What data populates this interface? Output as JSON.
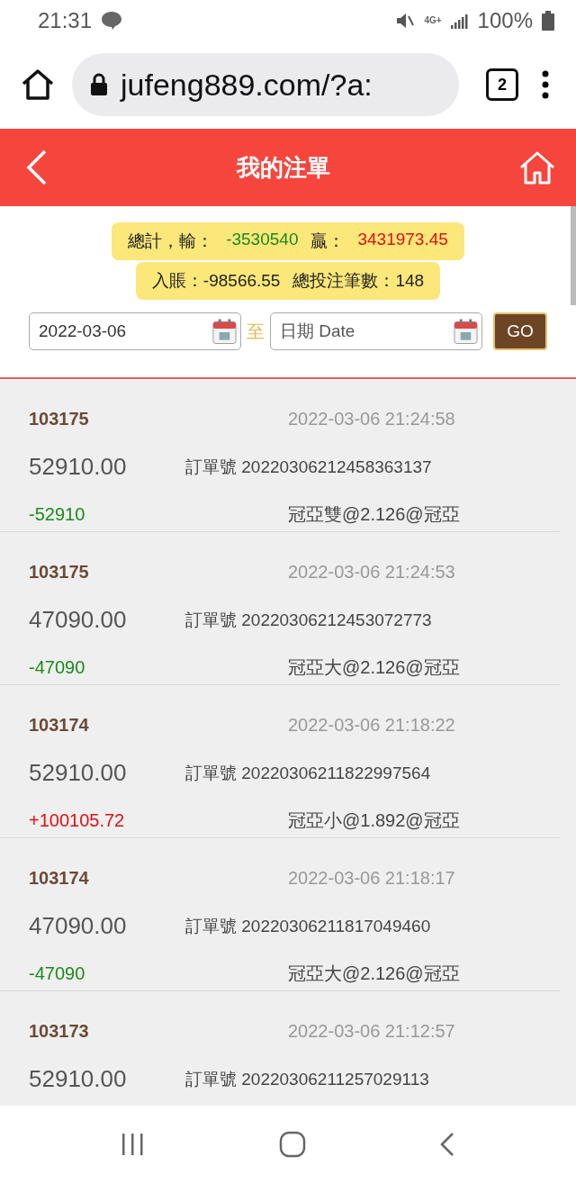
{
  "status_bar": {
    "time": "21:31",
    "network": "4G+",
    "battery": "100%"
  },
  "browser": {
    "url": "jufeng889.com/?a:",
    "tab_count": "2"
  },
  "header": {
    "title": "我的注單"
  },
  "summary": {
    "line1": [
      {
        "text": "總計，輸：",
        "color": "#222222"
      },
      {
        "text": "-3530540",
        "color": "#1a8a1a"
      },
      {
        "text": "贏：",
        "color": "#222222"
      },
      {
        "text": "3431973.45",
        "color": "#e01010"
      }
    ],
    "line2": [
      {
        "text": "入賬：-98566.55",
        "color": "#222222"
      },
      {
        "text": "總投注筆數：148",
        "color": "#222222"
      }
    ]
  },
  "filter": {
    "from": "2022-03-06",
    "separator": "至",
    "to_placeholder": "日期 Date",
    "go": "GO"
  },
  "bets": [
    {
      "id": "103175",
      "time": "2022-03-06 21:24:58",
      "amount": "52910.00",
      "order": "訂單號 20220306212458363137",
      "result": "-52910",
      "color": "#1a8a1a",
      "bet": "冠亞雙@2.126@冠亞"
    },
    {
      "id": "103175",
      "time": "2022-03-06 21:24:53",
      "amount": "47090.00",
      "order": "訂單號 20220306212453072773",
      "result": "-47090",
      "color": "#1a8a1a",
      "bet": "冠亞大@2.126@冠亞"
    },
    {
      "id": "103174",
      "time": "2022-03-06 21:18:22",
      "amount": "52910.00",
      "order": "訂單號 20220306211822997564",
      "result": "+100105.72",
      "color": "#e01010",
      "bet": "冠亞小@1.892@冠亞"
    },
    {
      "id": "103174",
      "time": "2022-03-06 21:18:17",
      "amount": "47090.00",
      "order": "訂單號 20220306211817049460",
      "result": "-47090",
      "color": "#1a8a1a",
      "bet": "冠亞大@2.126@冠亞"
    },
    {
      "id": "103173",
      "time": "2022-03-06 21:12:57",
      "amount": "52910.00",
      "order": "訂單號 20220306211257029113"
    }
  ]
}
